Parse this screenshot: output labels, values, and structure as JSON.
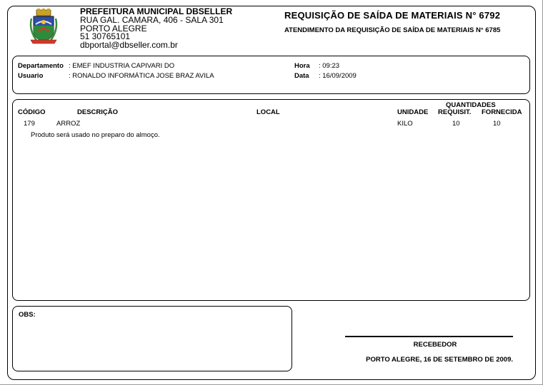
{
  "header": {
    "org_name": "PREFEITURA MUNICIPAL DBSELLER",
    "address": "RUA GAL. CAMARA, 406 - SALA 301",
    "city": "PORTO ALEGRE",
    "phone": "51 30765101",
    "email": "dbportal@dbseller.com.br",
    "title": "REQUISIÇÃO DE SAÍDA DE MATERIAIS N° 6792",
    "subtitle": "ATENDIMENTO DA REQUISIÇÃO DE SAÍDA DE MATERIAIS N° 6785",
    "crest_icon": "municipal-coat-of-arms-icon"
  },
  "info": {
    "departamento_label": "Departamento",
    "departamento_value": ":  EMEF INDUSTRIA CAPIVARI DO",
    "usuario_label": "Usuario",
    "usuario_value": ":  RONALDO INFORMÁTICA JOSE BRAZ AVILA",
    "hora_label": "Hora",
    "hora_value": ":  09:23",
    "data_label": "Data",
    "data_value": ":  16/09/2009"
  },
  "items": {
    "group_header": "QUANTIDADES",
    "columns": {
      "codigo": "CÓDIGO",
      "descricao": "DESCRIÇÃO",
      "local": "LOCAL",
      "unidade": "UNIDADE",
      "requisit": "REQUISIT.",
      "fornecida": "FORNECIDA"
    },
    "rows": [
      {
        "codigo": "179",
        "descricao": "ARROZ",
        "local": "",
        "unidade": "KILO",
        "requisit": "10",
        "fornecida": "10",
        "note": "Produto será usado no preparo do almoço."
      }
    ]
  },
  "obs": {
    "label": "OBS:"
  },
  "signature": {
    "label": "RECEBEDOR",
    "place_date": "PORTO ALEGRE, 16 DE SETEMBRO DE 2009."
  }
}
